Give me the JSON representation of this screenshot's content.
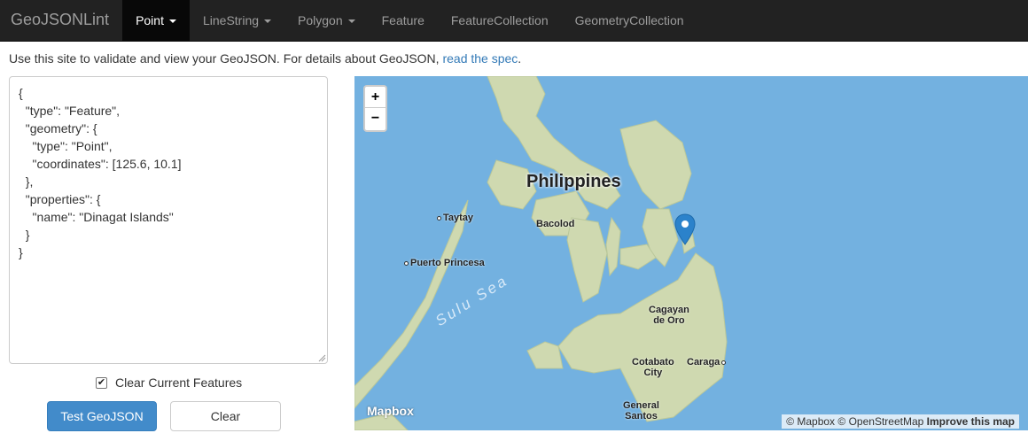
{
  "navbar": {
    "brand": "GeoJSONLint",
    "items": [
      {
        "label": "Point",
        "dropdown": true,
        "active": true
      },
      {
        "label": "LineString",
        "dropdown": true,
        "active": false
      },
      {
        "label": "Polygon",
        "dropdown": true,
        "active": false
      },
      {
        "label": "Feature",
        "dropdown": false,
        "active": false
      },
      {
        "label": "FeatureCollection",
        "dropdown": false,
        "active": false
      },
      {
        "label": "GeometryCollection",
        "dropdown": false,
        "active": false
      }
    ]
  },
  "intro": {
    "text": "Use this site to validate and view your GeoJSON. For details about GeoJSON, ",
    "link": "read the spec",
    "suffix": "."
  },
  "editor": {
    "value": "{\n  \"type\": \"Feature\",\n  \"geometry\": {\n    \"type\": \"Point\",\n    \"coordinates\": [125.6, 10.1]\n  },\n  \"properties\": {\n    \"name\": \"Dinagat Islands\"\n  }\n}"
  },
  "controls": {
    "clear_checkbox_label": "Clear Current Features",
    "clear_checkbox_checked": true,
    "test_button": "Test GeoJSON",
    "clear_button": "Clear"
  },
  "map": {
    "zoom_in": "+",
    "zoom_out": "−",
    "labels": {
      "country": "Philippines",
      "sea": "Sulu Sea",
      "taytay": "Taytay",
      "puerto": "Puerto Princesa",
      "bacolod": "Bacolod",
      "cagayan1": "Cagayan",
      "cagayan2": "de Oro",
      "cotabato1": "Cotabato",
      "cotabato2": "City",
      "caraga": "Caraga",
      "gensan1": "General",
      "gensan2": "Santos"
    },
    "logo": "Mapbox",
    "attribution": {
      "mapbox": "© Mapbox",
      "osm": "© OpenStreetMap",
      "improve": "Improve this map"
    },
    "marker_color": "#2b82cb",
    "water_color": "#73b1e0",
    "land_color": "#cfd9b0"
  }
}
